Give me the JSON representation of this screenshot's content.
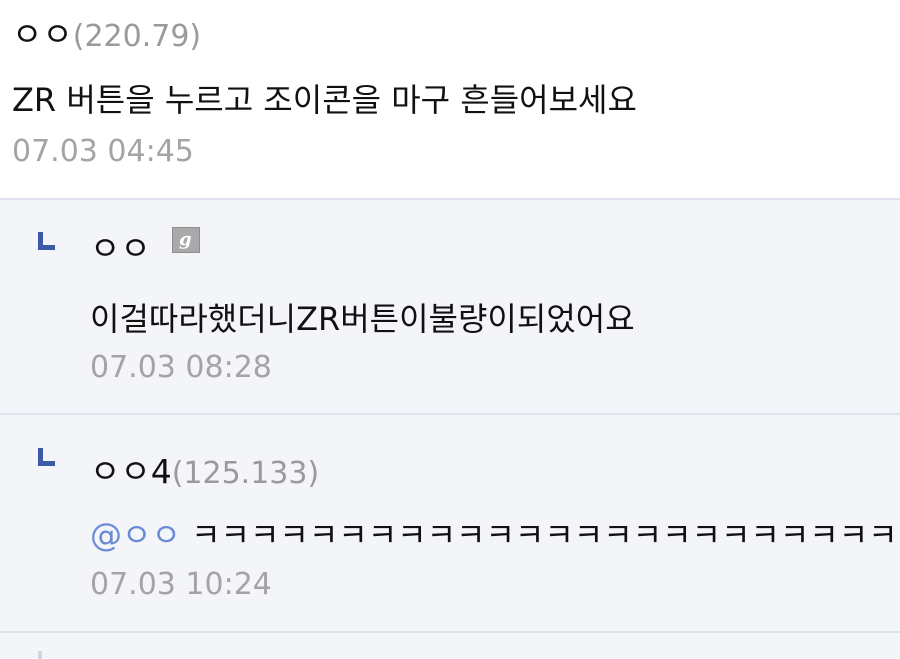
{
  "comments": [
    {
      "author": "ㅇㅇ",
      "ip": "(220.79)",
      "text": "ZR 버튼을 누르고 조이콘을 마구 흔들어보세요",
      "time": "07.03 04:45"
    }
  ],
  "replies": [
    {
      "author": "ㅇㅇ",
      "icon": "gallog-icon",
      "text": "이걸따라했더니ZR버튼이불량이되었어요",
      "time": "07.03 08:28"
    },
    {
      "author": "ㅇㅇ4",
      "ip": "(125.133)",
      "mention": "@ㅇㅇ",
      "text": "ㅋㅋㅋㅋㅋㅋㅋㅋㅋㅋㅋㅋㅋㅋㅋㅋㅋㅋㅋㅋㅋㅋㅋㅋㅋ",
      "time": "07.03 10:24"
    }
  ],
  "colors": {
    "reply_bg": "#f4f5f9",
    "divider": "#dfe2ec",
    "reply_arrow": "#3d5aa8",
    "mention": "#6b8bd6",
    "meta_gray": "#a4a4a4"
  }
}
